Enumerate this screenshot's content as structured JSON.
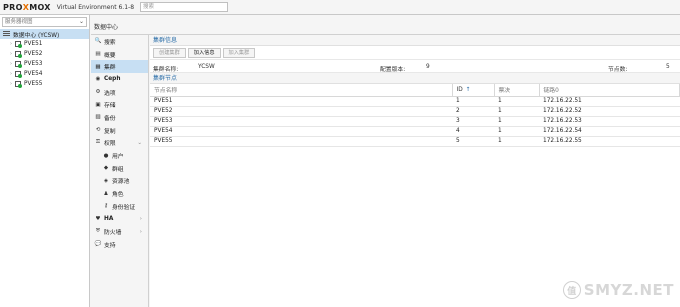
{
  "app": {
    "logo_prefix": "PRO",
    "logo_x": "X",
    "logo_suffix": "MOX",
    "version": "Virtual Environment 6.1-8",
    "search_placeholder": "搜索"
  },
  "tree": {
    "view_select": "服务器视图",
    "root": "数据中心 (YCSW)",
    "nodes": [
      "PVE51",
      "PVE52",
      "PVE53",
      "PVE54",
      "PVE55"
    ]
  },
  "main": {
    "header": "数据中心"
  },
  "subnav": {
    "items": [
      {
        "label": "搜索",
        "icon": "search-icon",
        "glyph": "🔍"
      },
      {
        "label": "概要",
        "icon": "book-icon",
        "glyph": "▤"
      },
      {
        "label": "集群",
        "icon": "server-icon",
        "glyph": "▦",
        "active": true
      },
      {
        "label": "Ceph",
        "icon": "ceph-icon",
        "glyph": "◉",
        "bold": true
      },
      {
        "label": "选项",
        "icon": "gear-icon",
        "glyph": "⚙"
      },
      {
        "label": "存储",
        "icon": "database-icon",
        "glyph": "▣"
      },
      {
        "label": "备份",
        "icon": "floppy-icon",
        "glyph": "▨"
      },
      {
        "label": "复制",
        "icon": "retweet-icon",
        "glyph": "⟲"
      },
      {
        "label": "权限",
        "icon": "unlock-icon",
        "glyph": "⚿",
        "expandable": "⌄"
      },
      {
        "label": "用户",
        "icon": "user-icon",
        "glyph": "●",
        "sub": true
      },
      {
        "label": "群组",
        "icon": "users-icon",
        "glyph": "◆",
        "sub": true
      },
      {
        "label": "资源池",
        "icon": "tags-icon",
        "glyph": "◈",
        "sub": true
      },
      {
        "label": "角色",
        "icon": "male-icon",
        "glyph": "♟",
        "sub": true
      },
      {
        "label": "身份验证",
        "icon": "key-icon",
        "glyph": "⚷",
        "sub": true
      },
      {
        "label": "HA",
        "icon": "heartbeat-icon",
        "glyph": "♥",
        "expandable": "›",
        "bold": true
      },
      {
        "label": "防火墙",
        "icon": "shield-icon",
        "glyph": "⛨",
        "expandable": "›"
      },
      {
        "label": "支持",
        "icon": "comments-icon",
        "glyph": "💬"
      }
    ]
  },
  "cluster_info": {
    "title": "集群信息",
    "buttons": [
      {
        "label": "创建集群",
        "enabled": false
      },
      {
        "label": "加入信息",
        "enabled": true
      },
      {
        "label": "加入集群",
        "enabled": false
      }
    ],
    "name_label": "集群名称:",
    "name_value": "YCSW",
    "config_label": "配置版本:",
    "config_value": "9",
    "nodes_label": "节点数:",
    "nodes_value": "5"
  },
  "cluster_nodes": {
    "title": "集群节点",
    "columns": {
      "name": "节点名称",
      "id": "ID",
      "votes": "票决",
      "link": "链路0"
    },
    "sort_glyph": "↑",
    "rows": [
      {
        "name": "PVE51",
        "id": "1",
        "votes": "1",
        "link": "172.16.22.51"
      },
      {
        "name": "PVE52",
        "id": "2",
        "votes": "1",
        "link": "172.16.22.52"
      },
      {
        "name": "PVE53",
        "id": "3",
        "votes": "1",
        "link": "172.16.22.53"
      },
      {
        "name": "PVE54",
        "id": "4",
        "votes": "1",
        "link": "172.16.22.54"
      },
      {
        "name": "PVE55",
        "id": "5",
        "votes": "1",
        "link": "172.16.22.55"
      }
    ]
  },
  "watermark": {
    "badge": "值",
    "text": "SMYZ.NET"
  }
}
